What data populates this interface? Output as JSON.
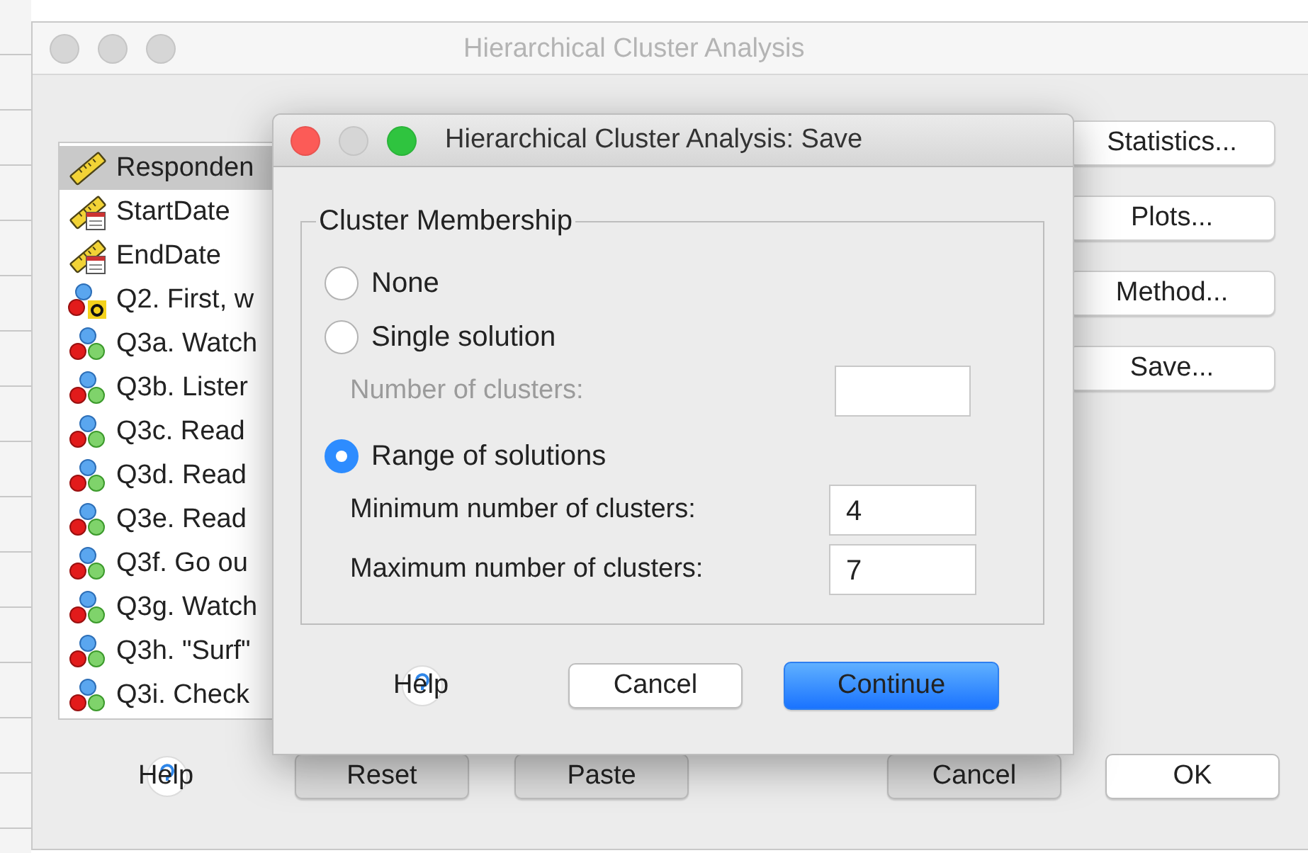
{
  "main_window": {
    "title": "Hierarchical Cluster Analysis",
    "variables": [
      {
        "label": "Responden",
        "kind": "scale",
        "selected": true
      },
      {
        "label": "StartDate",
        "kind": "date",
        "selected": false
      },
      {
        "label": "EndDate",
        "kind": "date",
        "selected": false
      },
      {
        "label": "Q2. First, w",
        "kind": "nominal-string",
        "selected": false
      },
      {
        "label": "Q3a. Watch",
        "kind": "nominal",
        "selected": false
      },
      {
        "label": "Q3b. Lister",
        "kind": "nominal",
        "selected": false
      },
      {
        "label": "Q3c. Read",
        "kind": "nominal",
        "selected": false
      },
      {
        "label": "Q3d. Read",
        "kind": "nominal",
        "selected": false
      },
      {
        "label": "Q3e. Read",
        "kind": "nominal",
        "selected": false
      },
      {
        "label": "Q3f. Go ou",
        "kind": "nominal",
        "selected": false
      },
      {
        "label": "Q3g. Watch",
        "kind": "nominal",
        "selected": false
      },
      {
        "label": "Q3h. \"Surf\"",
        "kind": "nominal",
        "selected": false
      },
      {
        "label": "Q3i. Check",
        "kind": "nominal",
        "selected": false
      }
    ],
    "side_buttons": [
      "Statistics...",
      "Plots...",
      "Method...",
      "Save..."
    ],
    "bottom_buttons": [
      {
        "label": "Help",
        "kind": "help"
      },
      {
        "label": "Reset",
        "kind": "plain"
      },
      {
        "label": "Paste",
        "kind": "plain"
      },
      {
        "label": "Cancel",
        "kind": "plain"
      },
      {
        "label": "OK",
        "kind": "default"
      }
    ]
  },
  "dialog": {
    "title": "Hierarchical Cluster Analysis: Save",
    "group_title": "Cluster Membership",
    "options": [
      {
        "kind": "radio",
        "label": "None",
        "selected": false
      },
      {
        "kind": "radio",
        "label": "Single solution",
        "selected": false
      },
      {
        "kind": "field",
        "label": "Number of clusters:",
        "disabled": true
      },
      {
        "kind": "radio",
        "label": "Range of solutions",
        "selected": true
      },
      {
        "kind": "field",
        "label": "Minimum number of clusters:",
        "value": "4",
        "disabled": false
      },
      {
        "kind": "field",
        "label": "Maximum number of clusters:",
        "value": "7",
        "disabled": false
      }
    ],
    "buttons": [
      {
        "label": "Help",
        "kind": "help"
      },
      {
        "label": "Cancel",
        "kind": "default"
      },
      {
        "label": "Continue",
        "kind": "primary"
      }
    ]
  }
}
